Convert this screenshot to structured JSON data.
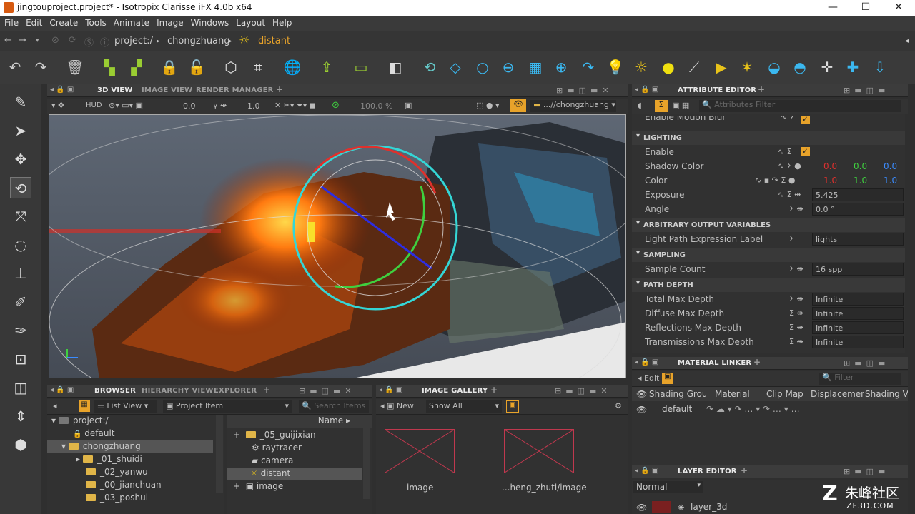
{
  "window": {
    "title": "jingtouproject.project* - Isotropix Clarisse iFX 4.0b x64",
    "min": "—",
    "max": "☐",
    "close": "✕"
  },
  "menu": [
    "File",
    "Edit",
    "Create",
    "Tools",
    "Animate",
    "Image",
    "Windows",
    "Layout",
    "Help"
  ],
  "path": {
    "root": "project:/",
    "ctx": "chongzhuang",
    "item": "distant"
  },
  "viewport": {
    "tabs": [
      "3D VIEW",
      "IMAGE VIEW",
      "RENDER MANAGER"
    ],
    "hud": "HUD",
    "v1": "0.0",
    "v2": "1.0",
    "zoom": "100.0 %",
    "ctx": "...//chongzhuang"
  },
  "attr": {
    "tab": "ATTRIBUTE EDITOR",
    "filter": "Attributes Filter",
    "top_label": "Enable Motion Blur",
    "s_lighting": "LIGHTING",
    "enable": "Enable",
    "shadow": "Shadow Color",
    "color": "Color",
    "exposure": "Exposure",
    "angle": "Angle",
    "sh_r": "0.0",
    "sh_g": "0.0",
    "sh_b": "0.0",
    "c_r": "1.0",
    "c_g": "1.0",
    "c_b": "1.0",
    "exposure_val": "5.425",
    "angle_val": "0.0 °",
    "s_aov": "ARBITRARY OUTPUT VARIABLES",
    "lpe": "Light Path Expression Label",
    "lpe_val": "lights",
    "s_sampling": "SAMPLING",
    "sample_count": "Sample Count",
    "sample_val": "16 spp",
    "s_path": "PATH DEPTH",
    "tmd": "Total Max Depth",
    "dmd": "Diffuse Max Depth",
    "rmd": "Reflections Max Depth",
    "trmd": "Transmissions Max Depth",
    "inf": "Infinite"
  },
  "matlinker": {
    "tab": "MATERIAL LINKER",
    "edit": "Edit",
    "filter": "Filter",
    "cols": [
      "Shading Group",
      "Material",
      "Clip Map",
      "Displacement",
      "Shading Variable"
    ],
    "row": "default"
  },
  "layer": {
    "tab": "LAYER EDITOR",
    "mode": "Normal",
    "item": "layer_3d"
  },
  "browser": {
    "tabs": [
      "BROWSER",
      "HIERARCHY VIEW",
      "EXPLORER"
    ],
    "listview": "List View",
    "projitem": "Project Item",
    "search": "Search Items",
    "name_col": "Name",
    "tree": [
      "project:/",
      "default",
      "chongzhuang",
      "_01_shuidi",
      "_02_yanwu",
      "_00_jianchuan",
      "_03_poshui"
    ],
    "items": [
      "_05_guijixian",
      "raytracer",
      "camera",
      "distant",
      "image"
    ]
  },
  "gallery": {
    "tab": "IMAGE GALLERY",
    "new": "New",
    "show": "Show All",
    "img1": "image",
    "img2": "...heng_zhuti/image"
  },
  "watermark": {
    "cn": "朱峰社区",
    "url": "ZF3D.COM"
  },
  "colors": {
    "accent": "#e8a32a",
    "red": "#e0302c",
    "green": "#3fd03f",
    "blue": "#3a8cff"
  }
}
